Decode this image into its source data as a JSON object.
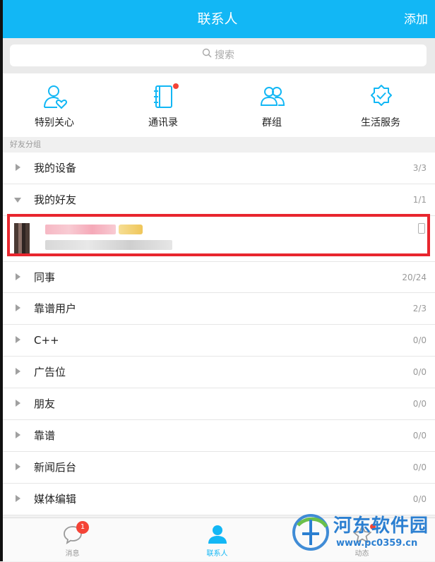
{
  "header": {
    "title": "联系人",
    "add_label": "添加"
  },
  "search": {
    "placeholder": "搜索"
  },
  "quick_links": [
    {
      "label": "特别关心",
      "icon": "person-heart-icon"
    },
    {
      "label": "通讯录",
      "icon": "address-book-icon"
    },
    {
      "label": "群组",
      "icon": "group-icon"
    },
    {
      "label": "生活服务",
      "icon": "verified-badge-icon"
    }
  ],
  "section_title": "好友分组",
  "groups": [
    {
      "name": "我的设备",
      "count": "3/3",
      "expanded": false
    },
    {
      "name": "我的好友",
      "count": "1/1",
      "expanded": true
    },
    {
      "name": "同事",
      "count": "20/24",
      "expanded": false
    },
    {
      "name": "靠谱用户",
      "count": "2/3",
      "expanded": false
    },
    {
      "name": "C++",
      "count": "0/0",
      "expanded": false
    },
    {
      "name": "广告位",
      "count": "0/0",
      "expanded": false
    },
    {
      "name": "朋友",
      "count": "0/0",
      "expanded": false
    },
    {
      "name": "靠谱",
      "count": "0/0",
      "expanded": false
    },
    {
      "name": "新闻后台",
      "count": "0/0",
      "expanded": false
    },
    {
      "name": "媒体编辑",
      "count": "0/0",
      "expanded": false
    }
  ],
  "bottom_nav": [
    {
      "label": "消息",
      "badge": "1"
    },
    {
      "label": "联系人",
      "active": true
    },
    {
      "label": "动态"
    }
  ],
  "watermark": {
    "title": "河东软件园",
    "url": "www.pc0359.cn"
  },
  "colors": {
    "accent": "#12b7f5",
    "highlight": "#e8262e",
    "badge": "#f44336"
  }
}
